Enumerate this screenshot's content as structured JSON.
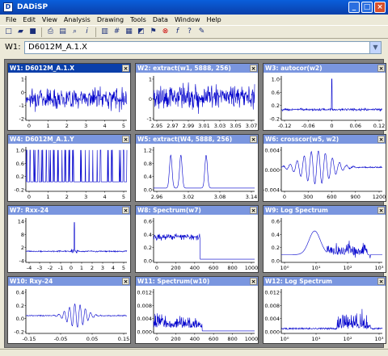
{
  "app": {
    "title": "DADiSP"
  },
  "menu": [
    "File",
    "Edit",
    "View",
    "Analysis",
    "Drawing",
    "Tools",
    "Data",
    "Window",
    "Help"
  ],
  "toolbar_icons": [
    "new-icon",
    "open-icon",
    "save-icon",
    "print-icon",
    "print-preview-icon",
    "find-icon",
    "info-icon",
    "chart-icon",
    "grid-icon",
    "table-icon",
    "graph-icon",
    "flag-icon",
    "cancel-icon",
    "function-icon",
    "help-icon",
    "edit-icon"
  ],
  "command": {
    "label": "W1:",
    "value": "D6012M_A.1.X"
  },
  "colors": {
    "trace": "#0000CC",
    "title_active": "#0A3FAA",
    "title_inactive": "#7A96DF",
    "workspace": "#808080"
  },
  "windows": [
    {
      "title": "W1: D6012M_A.1.X",
      "x_ticks": [
        "0",
        "1",
        "2",
        "3",
        "4",
        "5"
      ],
      "y_ticks": [
        "1",
        "0",
        "-1",
        "-2"
      ],
      "chart_data": {
        "type": "line",
        "kind": "noise",
        "xlim": [
          0,
          5
        ],
        "ylim": [
          -2.3,
          1.5
        ]
      }
    },
    {
      "title": "W2: extract(w1, 5888, 256)",
      "x_ticks": [
        "2.95",
        "2.97",
        "2.99",
        "3.01",
        "3.03",
        "3.05",
        "3.07"
      ],
      "y_ticks": [
        "1",
        "0",
        "-1"
      ],
      "chart_data": {
        "type": "line",
        "kind": "noise",
        "xlim": [
          2.94,
          3.08
        ],
        "ylim": [
          -1.6,
          1.4
        ]
      }
    },
    {
      "title": "W3: autocor(w2)",
      "x_ticks": [
        "-0.12",
        "-0.06",
        "0",
        "0.06",
        "0.12"
      ],
      "y_ticks": [
        "1.0",
        "0.6",
        "0.2",
        "-0.2"
      ],
      "chart_data": {
        "type": "line",
        "kind": "autocorr",
        "xlim": [
          -0.14,
          0.14
        ],
        "ylim": [
          -0.35,
          1.1
        ]
      }
    },
    {
      "title": "W4: D6012M_A.1.Y",
      "x_ticks": [
        "0",
        "1",
        "2",
        "3",
        "4",
        "5"
      ],
      "y_ticks": [
        "1.0",
        "0.6",
        "0.2",
        "-0.2"
      ],
      "chart_data": {
        "type": "line",
        "kind": "bursts",
        "xlim": [
          0,
          5
        ],
        "ylim": [
          -0.3,
          1.1
        ]
      }
    },
    {
      "title": "W5: extract(W4, 5888, 256)",
      "x_ticks": [
        "2.96",
        "3.02",
        "3.08",
        "3.14"
      ],
      "y_ticks": [
        "1.2",
        "0.8",
        "0.4",
        "0.0"
      ],
      "chart_data": {
        "type": "line",
        "kind": "pulses",
        "xlim": [
          2.94,
          3.2
        ],
        "ylim": [
          -0.1,
          1.25
        ]
      }
    },
    {
      "title": "W6: crosscor(w5, w2)",
      "x_ticks": [
        "0",
        "300",
        "600",
        "900",
        "1200"
      ],
      "y_ticks": [
        "0.004",
        "0.000",
        "-0.004"
      ],
      "chart_data": {
        "type": "line",
        "kind": "crosscorr",
        "xlim": [
          0,
          1280
        ],
        "ylim": [
          -0.0065,
          0.0055
        ]
      }
    },
    {
      "title": "W7: Rxx-24",
      "x_ticks": [
        "-4",
        "-3",
        "-2",
        "-1",
        "0",
        "1",
        "2",
        "3",
        "4",
        "5"
      ],
      "y_ticks": [
        "14",
        "8",
        "2",
        "-4"
      ],
      "chart_data": {
        "type": "line",
        "kind": "spike",
        "xlim": [
          -5,
          5.5
        ],
        "ylim": [
          -5,
          15
        ]
      }
    },
    {
      "title": "W8: Spectrum(w7)",
      "x_ticks": [
        "0",
        "200",
        "400",
        "600",
        "800",
        "1000"
      ],
      "y_ticks": [
        "0.6",
        "0.4",
        "0.2",
        "0.0"
      ],
      "chart_data": {
        "type": "line",
        "kind": "lowpass",
        "xlim": [
          0,
          1050
        ],
        "ylim": [
          -0.05,
          0.65
        ]
      }
    },
    {
      "title": "W9: Log Spectrum",
      "x_ticks": [
        "10⁰",
        "10¹",
        "10²",
        "10³"
      ],
      "y_ticks": [
        "0.6",
        "0.4",
        "0.2",
        "0.0"
      ],
      "chart_data": {
        "type": "line",
        "kind": "logspec",
        "xlim": [
          0,
          3
        ],
        "ylim": [
          -0.05,
          0.7
        ]
      }
    },
    {
      "title": "W10: Rxy-24",
      "x_ticks": [
        "-0.15",
        "-0.05",
        "0.05",
        "0.15"
      ],
      "y_ticks": [
        "0.4",
        "0.2",
        "0.0",
        "-0.2"
      ],
      "chart_data": {
        "type": "line",
        "kind": "rxy",
        "xlim": [
          -0.18,
          0.18
        ],
        "ylim": [
          -0.3,
          0.45
        ]
      }
    },
    {
      "title": "W11: Spectrum(w10)",
      "x_ticks": [
        "0",
        "200",
        "400",
        "600",
        "800",
        "1000"
      ],
      "y_ticks": [
        "0.012",
        "0.008",
        "0.004",
        "0.000"
      ],
      "chart_data": {
        "type": "line",
        "kind": "lowpass2",
        "xlim": [
          0,
          1050
        ],
        "ylim": [
          -0.0008,
          0.0135
        ]
      }
    },
    {
      "title": "W12: Log Spectrum",
      "x_ticks": [
        "10⁰",
        "10¹",
        "10²",
        "10³"
      ],
      "y_ticks": [
        "0.012",
        "0.008",
        "0.004",
        "0.000"
      ],
      "chart_data": {
        "type": "line",
        "kind": "logspec2",
        "xlim": [
          0,
          3
        ],
        "ylim": [
          -0.0008,
          0.0135
        ]
      }
    }
  ]
}
